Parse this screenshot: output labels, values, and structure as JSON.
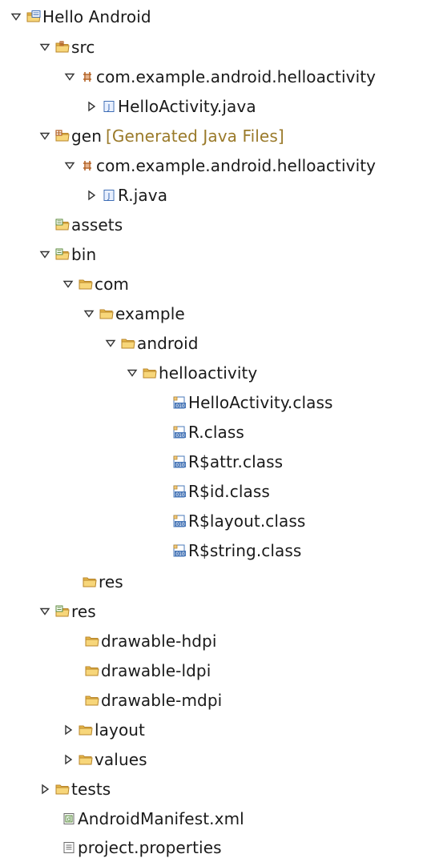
{
  "tree": {
    "rows": [
      {
        "label": "Hello Android",
        "icon": "project-icon",
        "toggle": "expanded"
      },
      {
        "label": "src",
        "icon": "source-folder-icon",
        "toggle": "expanded"
      },
      {
        "label": "com.example.android.helloactivity",
        "icon": "package-icon",
        "toggle": "expanded"
      },
      {
        "label": "HelloActivity.java",
        "icon": "java-file-icon",
        "toggle": "collapsed"
      },
      {
        "label": "gen",
        "decoration": "[Generated Java Files]",
        "icon": "generated-source-folder-icon",
        "toggle": "expanded"
      },
      {
        "label": "com.example.android.helloactivity",
        "icon": "package-icon",
        "toggle": "expanded"
      },
      {
        "label": "R.java",
        "icon": "java-file-icon",
        "toggle": "collapsed"
      },
      {
        "label": "assets",
        "icon": "resource-folder-icon",
        "toggle": "none"
      },
      {
        "label": "bin",
        "icon": "resource-folder-icon",
        "toggle": "expanded"
      },
      {
        "label": "com",
        "icon": "folder-icon",
        "toggle": "expanded"
      },
      {
        "label": "example",
        "icon": "folder-icon",
        "toggle": "expanded"
      },
      {
        "label": "android",
        "icon": "folder-icon",
        "toggle": "expanded"
      },
      {
        "label": "helloactivity",
        "icon": "folder-icon",
        "toggle": "expanded"
      },
      {
        "label": "HelloActivity.class",
        "icon": "class-file-icon",
        "toggle": "none"
      },
      {
        "label": "R.class",
        "icon": "class-file-icon",
        "toggle": "none"
      },
      {
        "label": "R$attr.class",
        "icon": "class-file-icon",
        "toggle": "none"
      },
      {
        "label": "R$id.class",
        "icon": "class-file-icon",
        "toggle": "none"
      },
      {
        "label": "R$layout.class",
        "icon": "class-file-icon",
        "toggle": "none"
      },
      {
        "label": "R$string.class",
        "icon": "class-file-icon",
        "toggle": "none"
      },
      {
        "label": "res",
        "icon": "folder-icon",
        "toggle": "none"
      },
      {
        "label": "res",
        "icon": "resource-folder-icon",
        "toggle": "expanded"
      },
      {
        "label": "drawable-hdpi",
        "icon": "folder-icon",
        "toggle": "none"
      },
      {
        "label": "drawable-ldpi",
        "icon": "folder-icon",
        "toggle": "none"
      },
      {
        "label": "drawable-mdpi",
        "icon": "folder-icon",
        "toggle": "none"
      },
      {
        "label": "layout",
        "icon": "folder-icon",
        "toggle": "collapsed"
      },
      {
        "label": "values",
        "icon": "folder-icon",
        "toggle": "collapsed"
      },
      {
        "label": "tests",
        "icon": "folder-icon",
        "toggle": "collapsed"
      },
      {
        "label": "AndroidManifest.xml",
        "icon": "xml-file-icon",
        "toggle": "none"
      },
      {
        "label": "project.properties",
        "icon": "text-file-icon",
        "toggle": "none"
      }
    ]
  },
  "colors": {
    "folder": "#e8b84a",
    "folder_dark": "#b8862a",
    "package": "#b5652a",
    "java_blue": "#3b6bb5",
    "class_blue": "#4a78b8",
    "decoration_text": "#9a7a2a",
    "toggle": "#333333"
  }
}
